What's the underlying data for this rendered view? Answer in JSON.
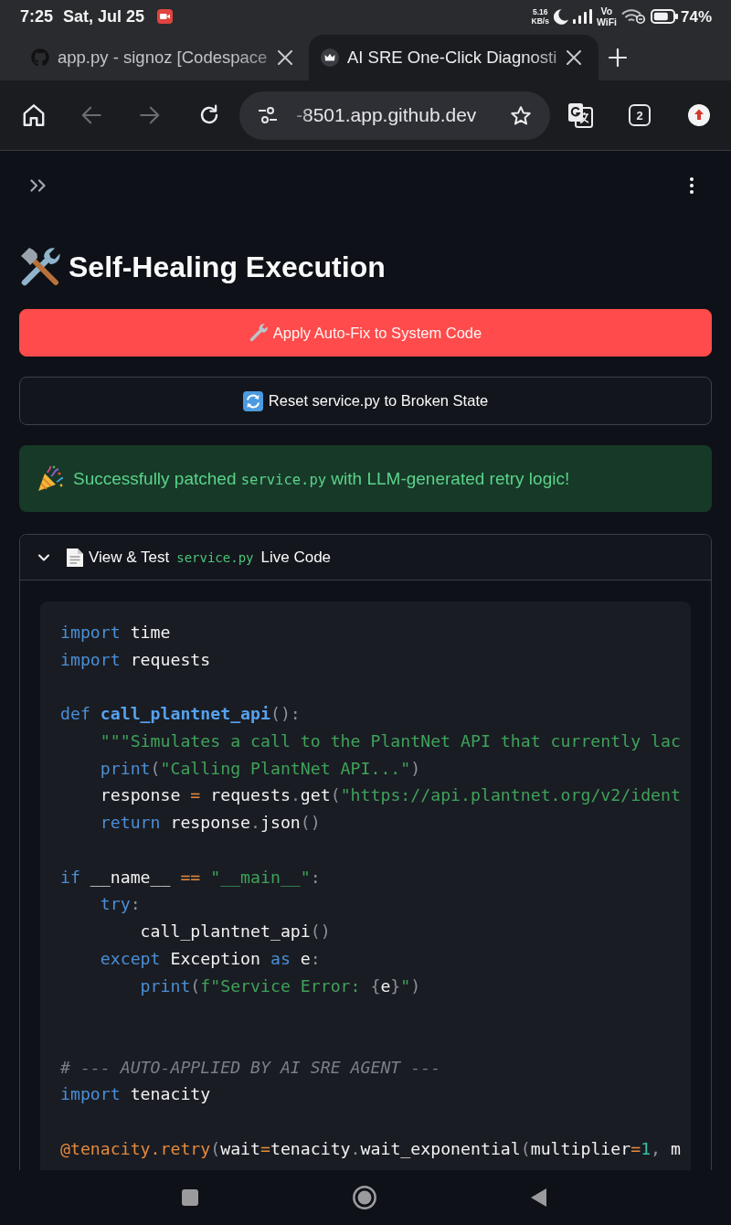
{
  "status_bar": {
    "time": "7:25",
    "date": "Sat, Jul 25",
    "net_speed": "5.16",
    "net_unit": "KB/s",
    "vowifi": [
      "Vo",
      "WiFi"
    ],
    "battery": "74%"
  },
  "tabs": [
    {
      "title": "app.py - signoz [Codespace",
      "selected": false
    },
    {
      "title": "AI SRE One-Click Diagnosti",
      "selected": true
    }
  ],
  "toolbar": {
    "back": {
      "disabled": true
    },
    "forward": {
      "disabled": true
    },
    "url": "-8501.app.github.dev",
    "tab_count": "2"
  },
  "page": {
    "title": "Self-Healing Execution",
    "buttons": [
      {
        "kind": "primary",
        "label": "Apply Auto-Fix to System Code"
      },
      {
        "kind": "secondary",
        "label": "Reset service.py to Broken State"
      }
    ],
    "alert": {
      "kind": "success",
      "parts": [
        {
          "kind": "text",
          "text": "Successfully patched "
        },
        {
          "kind": "code",
          "text": "service.py"
        },
        {
          "kind": "text",
          "text": " with LLM-generated retry logic!"
        }
      ]
    },
    "expander": {
      "expanded": true,
      "title_parts": [
        {
          "kind": "text",
          "text": "View & Test"
        },
        {
          "kind": "code",
          "text": "service.py"
        },
        {
          "kind": "text",
          "text": "Live Code"
        }
      ],
      "code": [
        {
          "kind": "code",
          "tokens": [
            {
              "kind": "keyword",
              "text": "import"
            },
            {
              "kind": "name",
              "text": " time"
            }
          ]
        },
        {
          "kind": "code",
          "tokens": [
            {
              "kind": "keyword",
              "text": "import"
            },
            {
              "kind": "name",
              "text": " requests"
            }
          ]
        },
        {
          "kind": "blank"
        },
        {
          "kind": "code",
          "tokens": [
            {
              "kind": "keyword",
              "text": "def"
            },
            {
              "kind": "function",
              "text": " call_plantnet_api"
            },
            {
              "kind": "punct",
              "text": "():"
            }
          ],
          "children": [
            {
              "kind": "code",
              "tokens": [
                {
                  "kind": "string",
                  "text": "\"\"\"Simulates a call to the PlantNet API that currently lac"
                }
              ]
            },
            {
              "kind": "code",
              "tokens": [
                {
                  "kind": "builtin",
                  "text": "print"
                },
                {
                  "kind": "punct",
                  "text": "("
                },
                {
                  "kind": "string",
                  "text": "\"Calling PlantNet API...\""
                },
                {
                  "kind": "punct",
                  "text": ")"
                }
              ]
            },
            {
              "kind": "code",
              "tokens": [
                {
                  "kind": "name",
                  "text": "response "
                },
                {
                  "kind": "operator",
                  "text": "="
                },
                {
                  "kind": "name",
                  "text": " requests"
                },
                {
                  "kind": "punct",
                  "text": "."
                },
                {
                  "kind": "name",
                  "text": "get"
                },
                {
                  "kind": "punct",
                  "text": "("
                },
                {
                  "kind": "string",
                  "text": "\"https://api.plantnet.org/v2/ident"
                }
              ]
            },
            {
              "kind": "code",
              "tokens": [
                {
                  "kind": "keyword",
                  "text": "return"
                },
                {
                  "kind": "name",
                  "text": " response"
                },
                {
                  "kind": "punct",
                  "text": "."
                },
                {
                  "kind": "name",
                  "text": "json"
                },
                {
                  "kind": "punct",
                  "text": "()"
                }
              ]
            }
          ]
        },
        {
          "kind": "blank"
        },
        {
          "kind": "code",
          "tokens": [
            {
              "kind": "keyword",
              "text": "if"
            },
            {
              "kind": "name",
              "text": " __name__ "
            },
            {
              "kind": "operator",
              "text": "=="
            },
            {
              "kind": "string",
              "text": " \"__main__\""
            },
            {
              "kind": "punct",
              "text": ":"
            }
          ],
          "children": [
            {
              "kind": "code",
              "tokens": [
                {
                  "kind": "keyword",
                  "text": "try"
                },
                {
                  "kind": "punct",
                  "text": ":"
                }
              ],
              "children": [
                {
                  "kind": "code",
                  "tokens": [
                    {
                      "kind": "name",
                      "text": "call_plantnet_api"
                    },
                    {
                      "kind": "punct",
                      "text": "()"
                    }
                  ]
                }
              ]
            },
            {
              "kind": "code",
              "tokens": [
                {
                  "kind": "keyword",
                  "text": "except"
                },
                {
                  "kind": "name",
                  "text": " Exception "
                },
                {
                  "kind": "keyword",
                  "text": "as"
                },
                {
                  "kind": "name",
                  "text": " e"
                },
                {
                  "kind": "punct",
                  "text": ":"
                }
              ],
              "children": [
                {
                  "kind": "code",
                  "tokens": [
                    {
                      "kind": "builtin",
                      "text": "print"
                    },
                    {
                      "kind": "punct",
                      "text": "("
                    },
                    {
                      "kind": "string",
                      "text": "f\"Service Error: "
                    },
                    {
                      "kind": "punct",
                      "text": "{"
                    },
                    {
                      "kind": "name",
                      "text": "e"
                    },
                    {
                      "kind": "punct",
                      "text": "}"
                    },
                    {
                      "kind": "string",
                      "text": "\""
                    },
                    {
                      "kind": "punct",
                      "text": ")"
                    }
                  ]
                }
              ]
            }
          ]
        },
        {
          "kind": "blank"
        },
        {
          "kind": "blank"
        },
        {
          "kind": "code",
          "tokens": [
            {
              "kind": "comment",
              "text": "# --- AUTO-APPLIED BY AI SRE AGENT ---"
            }
          ]
        },
        {
          "kind": "code",
          "tokens": [
            {
              "kind": "keyword",
              "text": "import"
            },
            {
              "kind": "name",
              "text": " tenacity"
            }
          ]
        },
        {
          "kind": "blank"
        },
        {
          "kind": "code",
          "tokens": [
            {
              "kind": "decorator",
              "text": "@tenacity.retry"
            },
            {
              "kind": "punct",
              "text": "("
            },
            {
              "kind": "name",
              "text": "wait"
            },
            {
              "kind": "operator",
              "text": "="
            },
            {
              "kind": "name",
              "text": "tenacity"
            },
            {
              "kind": "punct",
              "text": "."
            },
            {
              "kind": "name",
              "text": "wait_exponential"
            },
            {
              "kind": "punct",
              "text": "("
            },
            {
              "kind": "name",
              "text": "multiplier"
            },
            {
              "kind": "operator",
              "text": "="
            },
            {
              "kind": "number",
              "text": "1"
            },
            {
              "kind": "punct",
              "text": ","
            },
            {
              "kind": "name",
              "text": " m"
            }
          ]
        }
      ]
    }
  }
}
